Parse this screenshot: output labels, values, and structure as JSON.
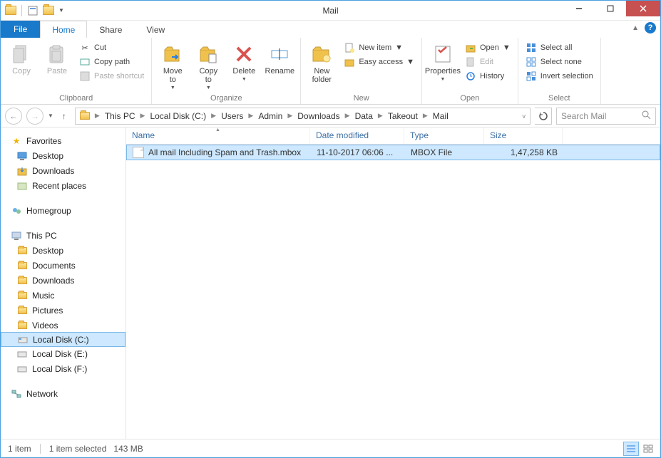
{
  "window": {
    "title": "Mail"
  },
  "tabs": {
    "file": "File",
    "home": "Home",
    "share": "Share",
    "view": "View"
  },
  "ribbon": {
    "clipboard": {
      "label": "Clipboard",
      "copy": "Copy",
      "paste": "Paste",
      "cut": "Cut",
      "copy_path": "Copy path",
      "paste_shortcut": "Paste shortcut"
    },
    "organize": {
      "label": "Organize",
      "move_to": "Move\nto",
      "copy_to": "Copy\nto",
      "delete": "Delete",
      "rename": "Rename"
    },
    "new": {
      "label": "New",
      "new_folder": "New\nfolder",
      "new_item": "New item",
      "easy_access": "Easy access"
    },
    "open": {
      "label": "Open",
      "properties": "Properties",
      "open": "Open",
      "edit": "Edit",
      "history": "History"
    },
    "select": {
      "label": "Select",
      "select_all": "Select all",
      "select_none": "Select none",
      "invert": "Invert selection"
    }
  },
  "breadcrumb": [
    "This PC",
    "Local Disk (C:)",
    "Users",
    "Admin",
    "Downloads",
    "Data",
    "Takeout",
    "Mail"
  ],
  "search": {
    "placeholder": "Search Mail"
  },
  "tree": {
    "favorites": {
      "label": "Favorites",
      "items": [
        "Desktop",
        "Downloads",
        "Recent places"
      ]
    },
    "homegroup": "Homegroup",
    "thispc": {
      "label": "This PC",
      "items": [
        "Desktop",
        "Documents",
        "Downloads",
        "Music",
        "Pictures",
        "Videos",
        "Local Disk (C:)",
        "Local Disk (E:)",
        "Local Disk (F:)"
      ]
    },
    "network": "Network"
  },
  "columns": {
    "name": "Name",
    "date": "Date modified",
    "type": "Type",
    "size": "Size"
  },
  "files": [
    {
      "name": "All mail Including Spam and Trash.mbox",
      "date": "11-10-2017 06:06 ...",
      "type": "MBOX File",
      "size": "1,47,258 KB"
    }
  ],
  "status": {
    "count": "1 item",
    "selected": "1 item selected",
    "size": "143 MB"
  }
}
